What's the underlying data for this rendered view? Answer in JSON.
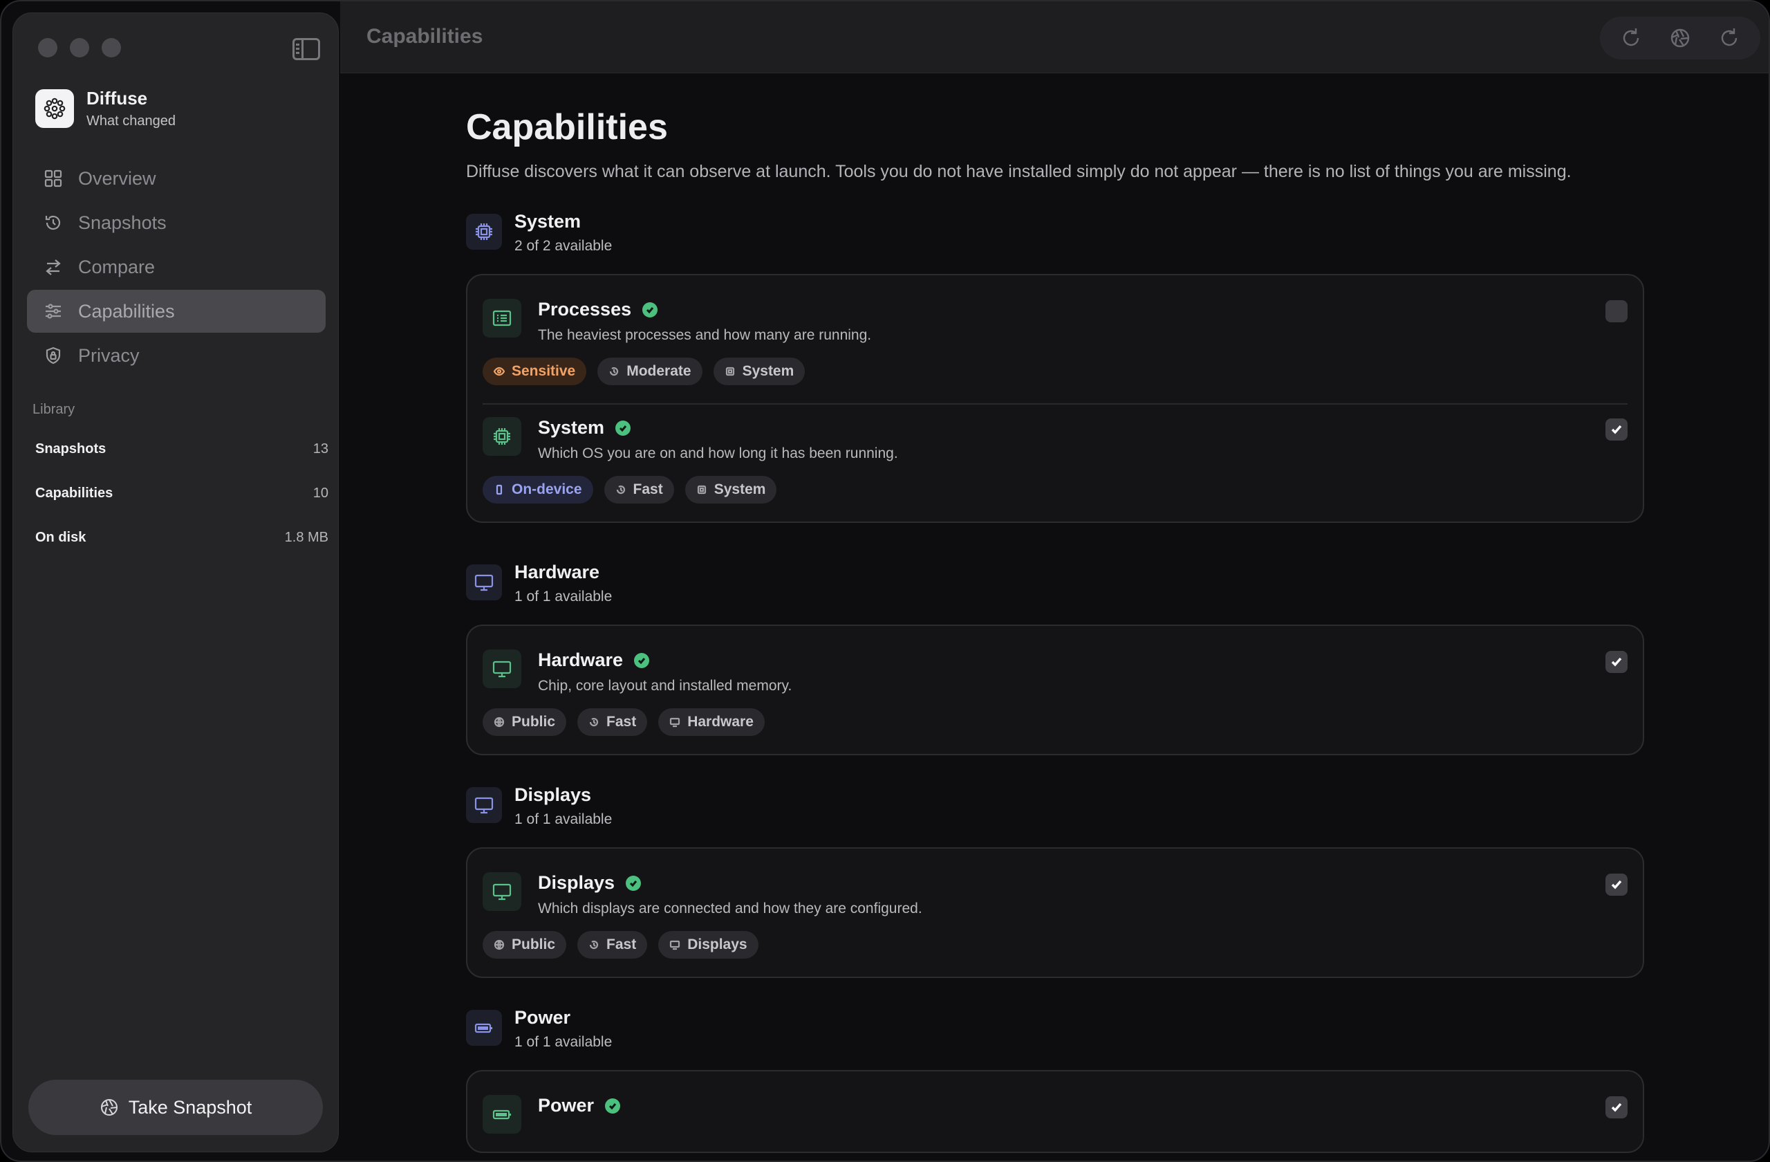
{
  "window": {
    "title": "Capabilities"
  },
  "sidebar": {
    "app_name": "Diffuse",
    "app_subtitle": "What changed",
    "nav": [
      {
        "label": "Overview",
        "icon": "grid-icon",
        "active": false
      },
      {
        "label": "Snapshots",
        "icon": "history-icon",
        "active": false
      },
      {
        "label": "Compare",
        "icon": "arrows-icon",
        "active": false
      },
      {
        "label": "Capabilities",
        "icon": "sliders-icon",
        "active": true
      },
      {
        "label": "Privacy",
        "icon": "shield-icon",
        "active": false
      }
    ],
    "library_label": "Library",
    "library": [
      {
        "label": "Snapshots",
        "value": "13"
      },
      {
        "label": "Capabilities",
        "value": "10"
      },
      {
        "label": "On disk",
        "value": "1.8 MB"
      }
    ],
    "take_snapshot": "Take Snapshot"
  },
  "main": {
    "title": "Capabilities",
    "description": "Diffuse discovers what it can observe at launch. Tools you do not have installed simply do not appear — there is no list of things you are missing.",
    "sections": [
      {
        "title": "System",
        "count": "2 of 2 available",
        "icon": "chip-icon",
        "items": [
          {
            "title": "Processes",
            "desc": "The heaviest processes and how many are running.",
            "checked": false,
            "icon": "list-icon",
            "tags": [
              {
                "label": "Sensitive",
                "kind": "sensitive"
              },
              {
                "label": "Moderate",
                "kind": "speed"
              },
              {
                "label": "System",
                "kind": "category"
              }
            ]
          },
          {
            "title": "System",
            "desc": "Which OS you are on and how long it has been running.",
            "checked": true,
            "icon": "chip-icon",
            "tags": [
              {
                "label": "On-device",
                "kind": "ondevice"
              },
              {
                "label": "Fast",
                "kind": "speed"
              },
              {
                "label": "System",
                "kind": "category"
              }
            ]
          }
        ]
      },
      {
        "title": "Hardware",
        "count": "1 of 1 available",
        "icon": "monitor-icon",
        "items": [
          {
            "title": "Hardware",
            "desc": "Chip, core layout and installed memory.",
            "checked": true,
            "icon": "monitor-icon",
            "tags": [
              {
                "label": "Public",
                "kind": "public"
              },
              {
                "label": "Fast",
                "kind": "speed"
              },
              {
                "label": "Hardware",
                "kind": "display"
              }
            ]
          }
        ]
      },
      {
        "title": "Displays",
        "count": "1 of 1 available",
        "icon": "monitor-icon",
        "items": [
          {
            "title": "Displays",
            "desc": "Which displays are connected and how they are configured.",
            "checked": true,
            "icon": "monitor-icon",
            "tags": [
              {
                "label": "Public",
                "kind": "public"
              },
              {
                "label": "Fast",
                "kind": "speed"
              },
              {
                "label": "Displays",
                "kind": "display"
              }
            ]
          }
        ]
      },
      {
        "title": "Power",
        "count": "1 of 1 available",
        "icon": "battery-icon",
        "items": [
          {
            "title": "Power",
            "desc": "",
            "checked": true,
            "icon": "battery-icon",
            "tags": []
          }
        ]
      }
    ]
  },
  "colors": {
    "accent_green": "#4cc07e",
    "accent_indigo": "#8b93e8",
    "sensitive_orange": "#f0a368"
  }
}
